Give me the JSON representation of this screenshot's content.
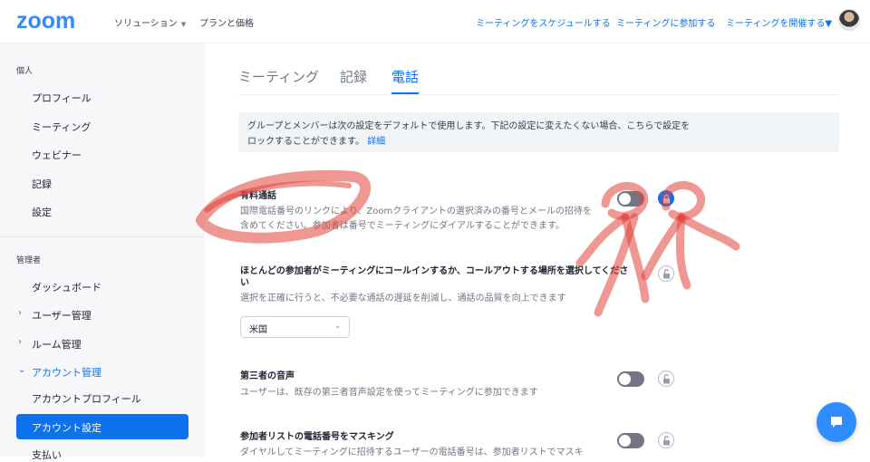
{
  "header": {
    "logo": "zoom",
    "nav": [
      {
        "label": "ソリューション",
        "has_caret": true
      },
      {
        "label": "プランと価格",
        "has_caret": false
      }
    ],
    "right_links": [
      {
        "label": "ミーティングをスケジュールする"
      },
      {
        "label": "ミーティングに参加する"
      },
      {
        "label": "ミーティングを開催する",
        "has_caret": true
      }
    ]
  },
  "sidebar": {
    "personal_heading": "個人",
    "personal_items": [
      "プロフィール",
      "ミーティング",
      "ウェビナー",
      "記録",
      "設定"
    ],
    "admin_heading": "管理者",
    "admin_items": [
      {
        "label": "ダッシュボード"
      },
      {
        "label": "ユーザー管理",
        "expandable": true
      },
      {
        "label": "ルーム管理",
        "expandable": true
      },
      {
        "label": "アカウント管理",
        "expandable": true,
        "expanded": true
      },
      {
        "label": "アカウントプロフィール"
      },
      {
        "label": "アカウント設定",
        "active": true
      },
      {
        "label": "支払い"
      }
    ]
  },
  "tabs": [
    {
      "label": "ミーティング",
      "active": false
    },
    {
      "label": "記録",
      "active": false
    },
    {
      "label": "電話",
      "active": true
    }
  ],
  "info": {
    "line1": "グループとメンバーは次の設定をデフォルトで使用します。下記の設定に変えたくない場合、こちらで設定を",
    "line2": "ロックすることができます。",
    "link": "詳細"
  },
  "settings": [
    {
      "title": "有料通話",
      "desc": "国際電話番号のリンクにより、Zoomクライアントの選択済みの番号とメールの招待を含めてください。参加者は番号でミーティングにダイアルすることができます。",
      "toggle_on": false,
      "locked": true
    },
    {
      "title": "ほとんどの参加者がミーティングにコールインするか、コールアウトする場所を選択してください",
      "desc": "選択を正確に行うと、不必要な通話の遅延を削減し、通話の品質を向上できます",
      "select_value": "米国",
      "locked": false
    },
    {
      "title": "第三者の音声",
      "desc": "ユーザーは、既存の第三者音声設定を使ってミーティングに参加できます",
      "toggle_on": false,
      "locked": false
    },
    {
      "title": "参加者リストの電話番号をマスキング",
      "desc": "ダイヤルしてミーティングに招待するユーザーの電話番号は、参加者リストでマスキ",
      "toggle_on": false,
      "locked": false
    }
  ],
  "colors": {
    "brand": "#2d8cff",
    "accent": "#0e72ed",
    "annotation": "#e0413a"
  }
}
